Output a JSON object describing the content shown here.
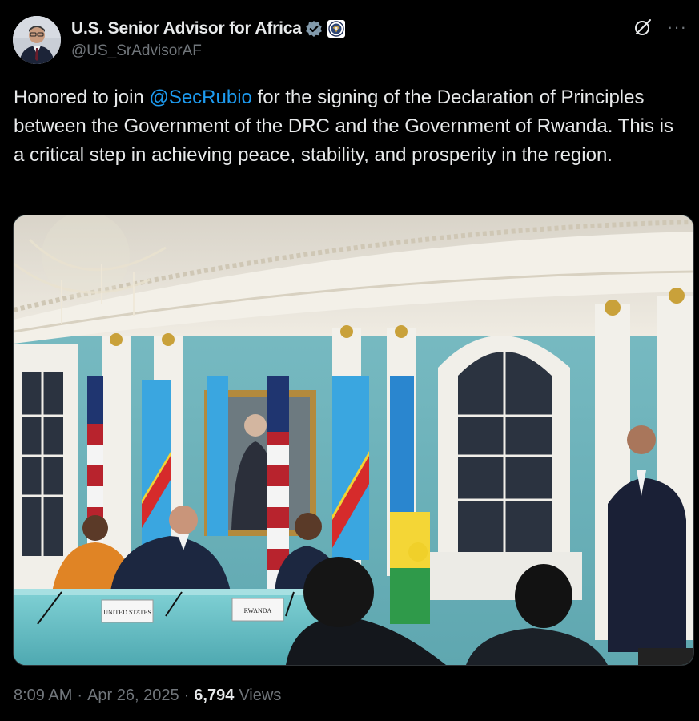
{
  "account": {
    "display_name": "U.S. Senior Advisor for Africa",
    "handle": "@US_SrAdvisorAF",
    "verified_color": "#829aab"
  },
  "tweet": {
    "text_before": "Honored to join ",
    "mention": "@SecRubio",
    "text_after": " for the signing of the Declaration of Principles between the Government of the DRC and the Government of Rwanda. This is a critical step in achieving peace, stability, and prosperity in the region."
  },
  "media": {
    "placards": [
      "UNITED STATES",
      "RWANDA"
    ]
  },
  "meta": {
    "time": "8:09 AM",
    "separator": "·",
    "date": "Apr 26, 2025",
    "views_count": "6,794",
    "views_label": "Views"
  },
  "colors": {
    "background": "#000000",
    "text": "#e7e9ea",
    "secondary": "#71767b",
    "link": "#1d9bf0"
  },
  "icons": [
    "avatar",
    "verified-badge-icon",
    "state-department-seal-icon",
    "grok-icon",
    "more-icon"
  ]
}
